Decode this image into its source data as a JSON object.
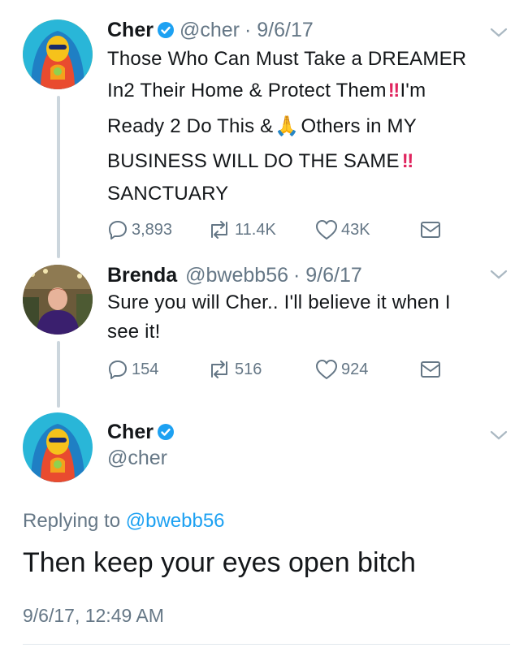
{
  "tweets": [
    {
      "name": "Cher",
      "handle": "@cher",
      "date": "· 9/6/17",
      "lines": [
        "Those Who Can Must Take a DREAMER",
        "In2 Their Home & Protect Them",
        "I'm",
        "Ready 2 Do This &",
        "Others in MY",
        "BUSINESS WILL DO THE SAME",
        "SANCTUARY"
      ],
      "replies": "3,893",
      "retweets": "11.4K",
      "likes": "43K"
    },
    {
      "name": "Brenda",
      "handle": "@bwebb56",
      "date": "· 9/6/17",
      "lines": [
        "Sure you will Cher.. I'll believe it when I",
        "see it!"
      ],
      "replies": "154",
      "retweets": "516",
      "likes": "924"
    }
  ],
  "main_tweet": {
    "name": "Cher",
    "handle": "@cher",
    "replying_label": "Replying to",
    "replying_handle": "@bwebb56",
    "text": "Then keep your eyes open bitch",
    "timestamp": "9/6/17, 12:49 AM"
  },
  "emoji": {
    "double_exclamation": "‼",
    "pray": "🙏"
  },
  "icons": [
    "verified-badge-icon",
    "chevron-down-icon",
    "reply-icon",
    "retweet-icon",
    "like-icon",
    "direct-message-icon"
  ],
  "colors": {
    "accent": "#1da1f2",
    "secondary_text": "#657786",
    "thread_line": "#ccd6dd",
    "alert_red": "#e0245e"
  }
}
